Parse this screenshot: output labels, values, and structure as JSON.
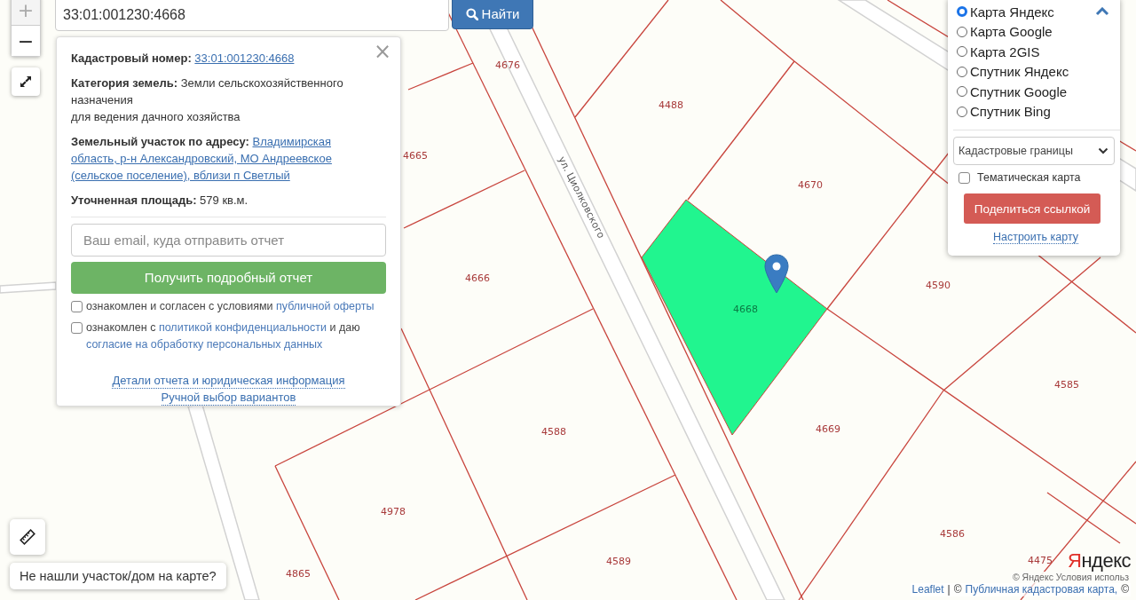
{
  "search": {
    "value": "33:01:001230:4668",
    "button": "Найти"
  },
  "zoom": {
    "zoom_in": "+",
    "zoom_out": "−"
  },
  "info_popup": {
    "close": "×",
    "rows": [
      {
        "kind": "link",
        "label": "Кадастровый номер:",
        "value_lines": [
          "33:01:001230:4668"
        ]
      },
      {
        "kind": "text",
        "label": "Категория земель:",
        "value_lines": [
          "Земли сельскохозяйственного назначения",
          "для ведения дачного хозяйства"
        ]
      },
      {
        "kind": "wrapped_link",
        "label": "Земельный участок по адресу:",
        "value_lines": [
          "Владимирская область, р-н Александровский, МО Андреевское (сельское поселение), вблизи п Светлый"
        ]
      },
      {
        "kind": "text",
        "label": "Уточненная площадь:",
        "value_lines": [
          "579 кв.м."
        ]
      }
    ],
    "email": {
      "placeholder": "Ваш email, куда отправить отчет"
    },
    "submit": "Получить подробный отчет",
    "consents": [
      {
        "checked": false,
        "parts": [
          {
            "text": "ознакомлен и согласен с условиями",
            "link": false
          },
          {
            "text": "публичной оферты",
            "link": true
          }
        ]
      },
      {
        "checked": false,
        "parts": [
          {
            "text": "ознакомлен с",
            "link": false
          },
          {
            "text": "политикой конфиденциальности",
            "link": true
          },
          {
            "text": "и даю",
            "link": false
          },
          {
            "text": "согласие на обработку персональных данных",
            "link": true
          }
        ]
      }
    ],
    "links": [
      "Детали отчета и юридическая информация",
      "Ручной выбор вариантов"
    ]
  },
  "layers": {
    "options": [
      {
        "label": "Карта Яндекс",
        "selected": true
      },
      {
        "label": "Карта Google",
        "selected": false
      },
      {
        "label": "Карта 2GIS",
        "selected": false
      },
      {
        "label": "Спутник Яндекс",
        "selected": false
      },
      {
        "label": "Спутник Google",
        "selected": false
      },
      {
        "label": "Спутник Bing",
        "selected": false
      }
    ],
    "overlay_select": "Кадастровые границы",
    "thematic": {
      "label": "Тематическая карта",
      "checked": false
    },
    "share": "Поделиться ссылкой",
    "configure": "Настроить карту"
  },
  "map": {
    "street": "ул. Циолковского",
    "parcels": [
      {
        "label": "4676"
      },
      {
        "label": "4488"
      },
      {
        "label": "4665"
      },
      {
        "label": "4670"
      },
      {
        "label": "4666"
      },
      {
        "label": "4590"
      },
      {
        "label": "4668"
      },
      {
        "label": "4585"
      },
      {
        "label": "4588"
      },
      {
        "label": "4669"
      },
      {
        "label": "4978"
      },
      {
        "label": "4586"
      },
      {
        "label": "4589"
      },
      {
        "label": "4865"
      },
      {
        "label": "4475"
      }
    ],
    "logo": {
      "first": "Я",
      "rest": "ндекс"
    },
    "provider_attribution": "© Яндекс  Условия использ",
    "attribution": [
      {
        "text": "Leaflet",
        "link": true
      },
      {
        "text": "|",
        "link": false
      },
      {
        "text": "©",
        "link": false
      },
      {
        "text": "Публичная кадастровая карта,",
        "link": true
      },
      {
        "text": "©",
        "link": false
      }
    ]
  },
  "not_found": "Не нашли участок/дом на карте?"
}
